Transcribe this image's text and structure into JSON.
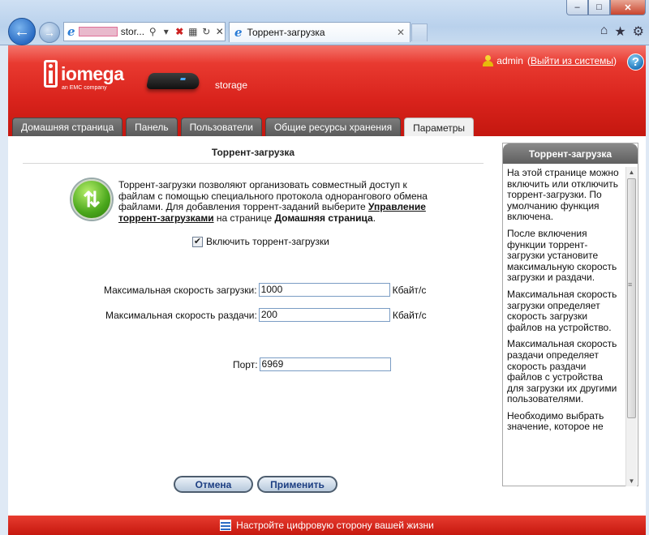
{
  "browser": {
    "address_host": "stor...",
    "tab_title": "Торрент-загрузка",
    "window_buttons": [
      "–",
      "□",
      "✕"
    ],
    "tool_icons": [
      "home-icon",
      "star-icon",
      "gear-icon"
    ]
  },
  "header": {
    "brand": "iomega",
    "brand_sub": "an EMC company",
    "device_name": "storage",
    "user": "admin",
    "logout_prefix": "(",
    "logout_label": "Выйти из системы",
    "logout_suffix": ")",
    "help": "?"
  },
  "menu": {
    "items": [
      {
        "label": "Домашняя страница"
      },
      {
        "label": "Панель"
      },
      {
        "label": "Пользователи"
      },
      {
        "label": "Общие ресурсы хранения"
      },
      {
        "label": "Параметры"
      }
    ]
  },
  "main": {
    "title": "Торрент-загрузка",
    "desc_1": "Торрент-загрузки позволяют организовать совместный доступ к файлам с помощью специального протокола однорангового обмена файлами. Для добавления торрент-заданий выберите ",
    "desc_link": "Управление торрент-загрузками",
    "desc_2": " на странице ",
    "desc_bold": "Домашняя страница",
    "desc_3": ".",
    "enable_label": "Включить торрент-загрузки",
    "enable_checked": "✔",
    "download_label": "Максимальная скорость загрузки:",
    "download_value": "1000",
    "download_unit": "Кбайт/с",
    "upload_label": "Максимальная скорость раздачи:",
    "upload_value": "200",
    "upload_unit": "Кбайт/с",
    "port_label": "Порт:",
    "port_value": "6969",
    "cancel": "Отмена",
    "apply": "Применить"
  },
  "help_pane": {
    "title": "Торрент-загрузка",
    "p1": "На этой странице можно включить или отключить торрент-загрузки. По умолчанию функция включена.",
    "p2": "После включения функции торрент-загрузки установите максимальную скорость загрузки и раздачи.",
    "p3": "Максимальная скорость загрузки определяет скорость загрузки файлов на устройство.",
    "p4": "Максимальная скорость раздачи определяет скорость раздачи файлов с устройства для загрузки их другими пользователями.",
    "p5": "Необходимо выбрать значение, которое не"
  },
  "footer": {
    "text": "Настройте цифровую сторону вашей жизни"
  }
}
